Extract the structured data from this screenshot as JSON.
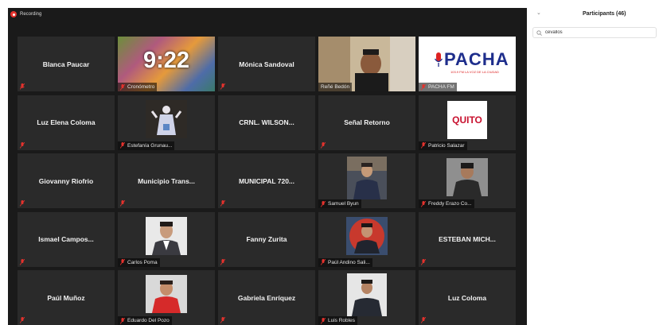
{
  "recording": {
    "label": "Recording"
  },
  "participants_panel": {
    "title": "Participants (46)",
    "search": {
      "value": "cevallos",
      "placeholder": ""
    }
  },
  "tiles": [
    {
      "type": "name",
      "text": "Blanca Paucar"
    },
    {
      "type": "clock",
      "time": "9:22",
      "label": "Cronómetro"
    },
    {
      "type": "name",
      "text": "Mónica Sandoval"
    },
    {
      "type": "video",
      "label": "Reñé Bedón",
      "active": true
    },
    {
      "type": "logo",
      "brand": "PACHA",
      "tagline": "103.9 FM LA VOZ DE LA CIUDAD",
      "label": "PACHA FM"
    },
    {
      "type": "name",
      "text": "Luz Elena Coloma"
    },
    {
      "type": "photo",
      "label": "Estefanía Grunau..."
    },
    {
      "type": "name",
      "text": "CRNL. WILSON..."
    },
    {
      "type": "name",
      "text": "Señal Retorno"
    },
    {
      "type": "logo-quito",
      "brand": "QUITO",
      "label": "Patricio Salazar"
    },
    {
      "type": "name",
      "text": "Giovanny Riofrio"
    },
    {
      "type": "name",
      "text": "Municipio Trans..."
    },
    {
      "type": "name",
      "text": "MUNICIPAL 720..."
    },
    {
      "type": "photo",
      "label": "Samuel Byun"
    },
    {
      "type": "photo",
      "label": "Freddy Erazo Co..."
    },
    {
      "type": "name",
      "text": "Ismael Campos..."
    },
    {
      "type": "photo",
      "label": "Carlos Poma"
    },
    {
      "type": "name",
      "text": "Fanny Zurita"
    },
    {
      "type": "photo",
      "label": "Paúl Andino Sali..."
    },
    {
      "type": "name",
      "text": "ESTEBAN MICH..."
    },
    {
      "type": "name",
      "text": "Paúl Muñoz"
    },
    {
      "type": "photo",
      "label": "Eduardo Del Pozo"
    },
    {
      "type": "name",
      "text": "Gabriela Enríquez"
    },
    {
      "type": "photo",
      "label": "Luis Robles"
    },
    {
      "type": "name",
      "text": "Luz Coloma"
    }
  ],
  "colors": {
    "active_speaker": "#7bc843",
    "muted_mic": "#e5322d",
    "recording": "#e5322d"
  }
}
